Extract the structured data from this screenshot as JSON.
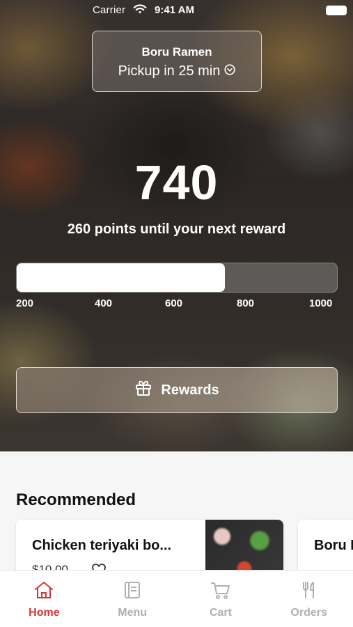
{
  "status_bar": {
    "carrier": "Carrier",
    "time": "9:41 AM"
  },
  "location": {
    "name": "Boru Ramen",
    "pickup": "Pickup in 25 min"
  },
  "points": {
    "value": "740",
    "subtitle": "260 points until your next reward",
    "progress_fraction": 0.65
  },
  "progress_ticks": [
    "200",
    "400",
    "600",
    "800",
    "1000"
  ],
  "rewards_button": {
    "label": "Rewards",
    "icon": "gift-icon"
  },
  "recommended": {
    "title": "Recommended",
    "items": [
      {
        "name": "Chicken teriyaki bo...",
        "price": "$10.00"
      },
      {
        "name": "Boru I"
      }
    ]
  },
  "tabs": [
    {
      "label": "Home",
      "icon": "home-icon",
      "active": true
    },
    {
      "label": "Menu",
      "icon": "menu-book-icon",
      "active": false
    },
    {
      "label": "Cart",
      "icon": "cart-icon",
      "active": false
    },
    {
      "label": "Orders",
      "icon": "fork-knife-icon",
      "active": false
    }
  ],
  "colors": {
    "accent": "#d8333a",
    "inactive": "#b0b0b0"
  }
}
